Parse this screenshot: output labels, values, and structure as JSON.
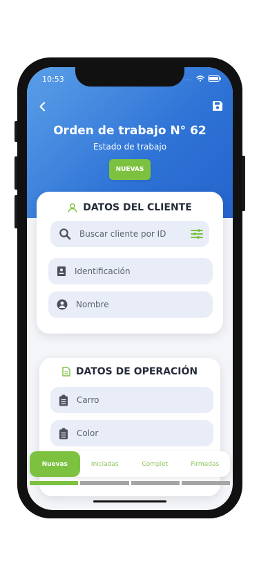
{
  "status_bar": {
    "time": "10:53",
    "signal_dots": "....",
    "icons": [
      "wifi-icon",
      "battery-icon"
    ]
  },
  "header": {
    "title": "Orden de trabajo N° 62",
    "subtitle": "Estado de trabajo",
    "status_badge": "NUEVAS",
    "icons": [
      "back-arrow-icon",
      "save-icon"
    ]
  },
  "client_section": {
    "title": "DATOS DEL CLIENTE",
    "search_placeholder": "Buscar cliente por ID",
    "id_placeholder": "Identificación",
    "name_placeholder": "Nombre",
    "icons": [
      "user-outline-icon",
      "search-icon",
      "filter-icon",
      "id-card-icon",
      "user-circle-icon"
    ]
  },
  "operation_section": {
    "title": "DATOS DE OPERACIÓN",
    "car_placeholder": "Carro",
    "color_placeholder": "Color",
    "icons": [
      "document-icon",
      "clipboard-icon"
    ]
  },
  "tabs": [
    {
      "label": "Nuevas",
      "active": true
    },
    {
      "label": "Iniciadas",
      "active": false
    },
    {
      "label": "Complet",
      "active": false
    },
    {
      "label": "Firmadas",
      "active": false
    }
  ],
  "colors": {
    "header_gradient_start": "#5b9fe8",
    "header_gradient_end": "#2563cc",
    "accent_green": "#7cc240",
    "field_bg": "#e8edf7",
    "inactive_bar": "#a5a5a5"
  }
}
